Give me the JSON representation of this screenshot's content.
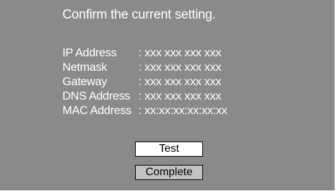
{
  "dialog": {
    "title": "Confirm the current setting.",
    "rows": [
      {
        "label": "IP Address",
        "value": ": xxx xxx xxx xxx"
      },
      {
        "label": "Netmask",
        "value": ": xxx xxx xxx xxx"
      },
      {
        "label": "Gateway",
        "value": ": xxx xxx xxx xxx"
      },
      {
        "label": "DNS Address",
        "value": ": xxx xxx xxx xxx"
      },
      {
        "label": "MAC Address",
        "value": ": xx:xx:xx:xx:xx:xx"
      }
    ],
    "buttons": {
      "test": "Test",
      "complete": "Complete"
    }
  },
  "colors": {
    "panel_background": "#8a8a8a",
    "text": "#ffffff",
    "test_button_bg": "#ffffff",
    "complete_button_bg": "#c2c2c2"
  }
}
